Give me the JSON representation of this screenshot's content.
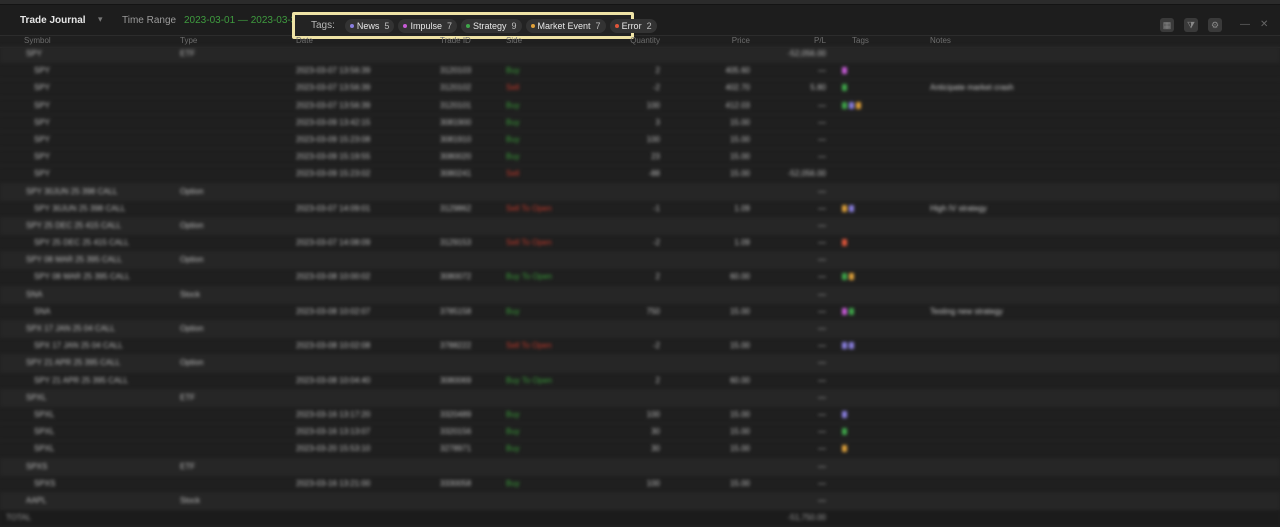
{
  "header": {
    "title": "Trade Journal",
    "range_label": "Time Range",
    "range_value": "2023-03-01 — 2023-03-31"
  },
  "tags_bar": {
    "label": "Tags:",
    "tags": [
      {
        "name": "News",
        "count": "5",
        "color": "#8a7fe0"
      },
      {
        "name": "Impulse",
        "count": "7",
        "color": "#c65bd6"
      },
      {
        "name": "Strategy",
        "count": "9",
        "color": "#3fa64a"
      },
      {
        "name": "Market Event",
        "count": "7",
        "color": "#e0a13a"
      },
      {
        "name": "Error",
        "count": "2",
        "color": "#e0553a"
      }
    ]
  },
  "columns": [
    "Symbol",
    "Type",
    "Date",
    "Trade ID",
    "Side",
    "Quantity",
    "Price",
    "P/L",
    "Tags",
    "Notes"
  ],
  "rows": [
    {
      "group": true,
      "sym": "SPY",
      "type": "ETF",
      "date": "",
      "id": "",
      "side": "",
      "qty": "",
      "price": "",
      "pl": "-52,056.00",
      "tags": [],
      "note": ""
    },
    {
      "group": false,
      "sym": "SPY",
      "type": "",
      "date": "2023-03-07 13:56:39",
      "id": "3120103",
      "side": "Buy",
      "sideClass": "pos",
      "qty": "2",
      "price": "405.60",
      "pl": "—",
      "tags": [
        "#c65bd6"
      ],
      "note": ""
    },
    {
      "group": false,
      "sym": "SPY",
      "type": "",
      "date": "2023-03-07 13:56:39",
      "id": "3120102",
      "side": "Sell",
      "sideClass": "neg",
      "qty": "-2",
      "price": "402.70",
      "pl": "5.80",
      "tags": [
        "#3fa64a"
      ],
      "note": "Anticipate market crash"
    },
    {
      "group": false,
      "sym": "SPY",
      "type": "",
      "date": "2023-03-07 13:56:39",
      "id": "3120101",
      "side": "Buy",
      "sideClass": "pos",
      "qty": "100",
      "price": "412.03",
      "pl": "—",
      "tags": [
        "#3fa64a",
        "#8a7fe0",
        "#e0a13a"
      ],
      "note": ""
    },
    {
      "group": false,
      "sym": "SPY",
      "type": "",
      "date": "2023-03-09 13:42:15",
      "id": "3081900",
      "side": "Buy",
      "sideClass": "pos",
      "qty": "3",
      "price": "15.00",
      "pl": "—",
      "tags": [],
      "note": ""
    },
    {
      "group": false,
      "sym": "SPY",
      "type": "",
      "date": "2023-03-09 15:23:08",
      "id": "3081910",
      "side": "Buy",
      "sideClass": "pos",
      "qty": "100",
      "price": "15.00",
      "pl": "—",
      "tags": [],
      "note": ""
    },
    {
      "group": false,
      "sym": "SPY",
      "type": "",
      "date": "2023-03-09 15:19:55",
      "id": "3080020",
      "side": "Buy",
      "sideClass": "pos",
      "qty": "23",
      "price": "15.00",
      "pl": "—",
      "tags": [],
      "note": ""
    },
    {
      "group": false,
      "sym": "SPY",
      "type": "",
      "date": "2023-03-09 15:23:02",
      "id": "3080241",
      "side": "Sell",
      "sideClass": "neg",
      "qty": "-88",
      "price": "15.00",
      "pl": "-52,056.00",
      "tags": [],
      "note": ""
    },
    {
      "group": true,
      "sym": "SPY 30JUN 25 398 CALL",
      "type": "Option",
      "date": "",
      "id": "",
      "side": "",
      "qty": "",
      "price": "",
      "pl": "—",
      "tags": [],
      "note": ""
    },
    {
      "group": false,
      "sym": "SPY 30JUN 25 398 CALL",
      "type": "",
      "date": "2023-03-07 14:09:01",
      "id": "3129862",
      "side": "Sell To Open",
      "sideClass": "neg",
      "qty": "-1",
      "price": "1.09",
      "pl": "—",
      "tags": [
        "#e0a13a",
        "#8a7fe0"
      ],
      "note": "High IV strategy"
    },
    {
      "group": true,
      "sym": "SPY 25 DEC 25 415 CALL",
      "type": "Option",
      "date": "",
      "id": "",
      "side": "",
      "qty": "",
      "price": "",
      "pl": "—",
      "tags": [],
      "note": ""
    },
    {
      "group": false,
      "sym": "SPY 25 DEC 25 415 CALL",
      "type": "",
      "date": "2023-03-07 14:08:09",
      "id": "3129153",
      "side": "Sell To Open",
      "sideClass": "neg",
      "qty": "-2",
      "price": "1.09",
      "pl": "—",
      "tags": [
        "#e0553a"
      ],
      "note": ""
    },
    {
      "group": true,
      "sym": "SPY 08 MAR 25 395 CALL",
      "type": "Option",
      "date": "",
      "id": "",
      "side": "",
      "qty": "",
      "price": "",
      "pl": "—",
      "tags": [],
      "note": ""
    },
    {
      "group": false,
      "sym": "SPY 08 MAR 25 395 CALL",
      "type": "",
      "date": "2023-03-08 10:00:02",
      "id": "3080072",
      "side": "Buy To Open",
      "sideClass": "pos",
      "qty": "2",
      "price": "60.00",
      "pl": "—",
      "tags": [
        "#3fa64a",
        "#e0a13a"
      ],
      "note": ""
    },
    {
      "group": true,
      "sym": "SNA",
      "type": "Stock",
      "date": "",
      "id": "",
      "side": "",
      "qty": "",
      "price": "",
      "pl": "—",
      "tags": [],
      "note": ""
    },
    {
      "group": false,
      "sym": "SNA",
      "type": "",
      "date": "2023-03-08 10:02:07",
      "id": "3785158",
      "side": "Buy",
      "sideClass": "pos",
      "qty": "750",
      "price": "15.00",
      "pl": "—",
      "tags": [
        "#c65bd6",
        "#3fa64a"
      ],
      "note": "Testing new strategy"
    },
    {
      "group": true,
      "sym": "SPX 17 JAN 25 04 CALL",
      "type": "Option",
      "date": "",
      "id": "",
      "side": "",
      "qty": "",
      "price": "",
      "pl": "—",
      "tags": [],
      "note": ""
    },
    {
      "group": false,
      "sym": "SPX 17 JAN 25 04 CALL",
      "type": "",
      "date": "2023-03-08 10:02:08",
      "id": "3788222",
      "side": "Sell To Open",
      "sideClass": "neg",
      "qty": "-2",
      "price": "15.00",
      "pl": "—",
      "tags": [
        "#8a7fe0",
        "#8a7fe0"
      ],
      "note": ""
    },
    {
      "group": true,
      "sym": "SPY 21 APR 25 395 CALL",
      "type": "Option",
      "date": "",
      "id": "",
      "side": "",
      "qty": "",
      "price": "",
      "pl": "—",
      "tags": [],
      "note": ""
    },
    {
      "group": false,
      "sym": "SPY 21 APR 25 395 CALL",
      "type": "",
      "date": "2023-03-08 10:04:40",
      "id": "3080069",
      "side": "Buy To Open",
      "sideClass": "pos",
      "qty": "2",
      "price": "60.00",
      "pl": "—",
      "tags": [],
      "note": ""
    },
    {
      "group": true,
      "sym": "SPXL",
      "type": "ETF",
      "date": "",
      "id": "",
      "side": "",
      "qty": "",
      "price": "",
      "pl": "—",
      "tags": [],
      "note": ""
    },
    {
      "group": false,
      "sym": "SPXL",
      "type": "",
      "date": "2023-03-16 13:17:20",
      "id": "3320489",
      "side": "Buy",
      "sideClass": "pos",
      "qty": "100",
      "price": "15.00",
      "pl": "—",
      "tags": [
        "#8a7fe0"
      ],
      "note": ""
    },
    {
      "group": false,
      "sym": "SPXL",
      "type": "",
      "date": "2023-03-16 13:13:07",
      "id": "3320156",
      "side": "Buy",
      "sideClass": "pos",
      "qty": "30",
      "price": "15.00",
      "pl": "—",
      "tags": [
        "#3fa64a"
      ],
      "note": ""
    },
    {
      "group": false,
      "sym": "SPXL",
      "type": "",
      "date": "2023-03-20 15:53:10",
      "id": "3278971",
      "side": "Buy",
      "sideClass": "pos",
      "qty": "30",
      "price": "15.00",
      "pl": "—",
      "tags": [
        "#e0a13a"
      ],
      "note": ""
    },
    {
      "group": true,
      "sym": "SPXS",
      "type": "ETF",
      "date": "",
      "id": "",
      "side": "",
      "qty": "",
      "price": "",
      "pl": "—",
      "tags": [],
      "note": ""
    },
    {
      "group": false,
      "sym": "SPXS",
      "type": "",
      "date": "2023-03-16 13:21:00",
      "id": "3330058",
      "side": "Buy",
      "sideClass": "pos",
      "qty": "100",
      "price": "15.00",
      "pl": "—",
      "tags": [],
      "note": ""
    },
    {
      "group": true,
      "sym": "AAPL",
      "type": "Stock",
      "date": "",
      "id": "",
      "side": "",
      "qty": "",
      "price": "",
      "pl": "—",
      "tags": [],
      "note": ""
    }
  ],
  "total": {
    "label": "TOTAL",
    "pl": "-51,750.00"
  }
}
